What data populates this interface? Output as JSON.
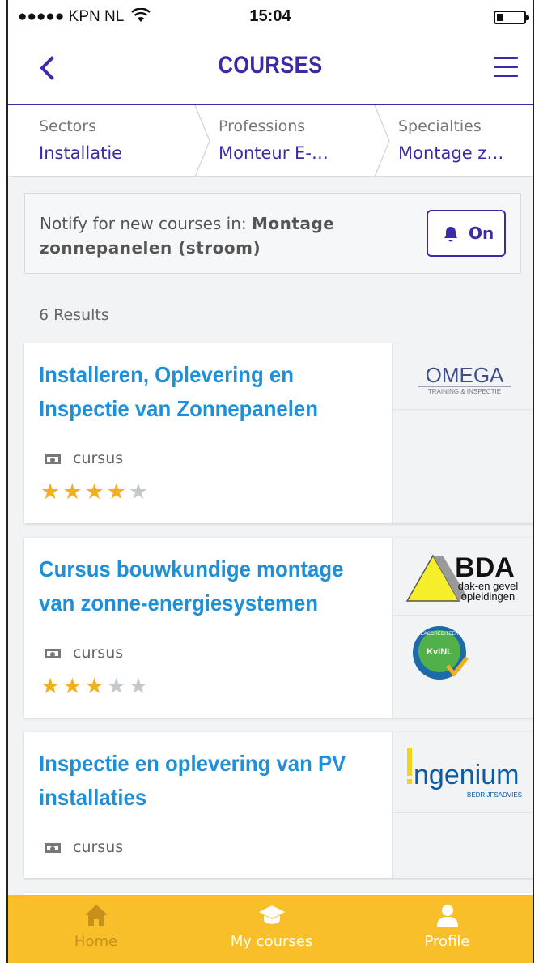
{
  "status_bar": {
    "carrier": "●●●●● KPN NL",
    "time": "15:04"
  },
  "header": {
    "title": "COURSES"
  },
  "breadcrumbs": [
    {
      "label": "Sectors",
      "value": "Installatie"
    },
    {
      "label": "Professions",
      "value": "Monteur E-…"
    },
    {
      "label": "Specialties",
      "value": "Montage z…"
    }
  ],
  "notify": {
    "prefix": "Notify for new courses in: ",
    "topic": "Montage zonnepanelen (stroom)",
    "button_label": "On"
  },
  "results": {
    "count_text": "6 Results"
  },
  "courses": [
    {
      "title": "Installeren, Oplevering en Inspectie van Zonnepanelen",
      "type": "cursus",
      "rating": 4,
      "providers": [
        "OMEGA"
      ],
      "provider_logo": {
        "name": "OMEGA",
        "tagline": "TRAINING & INSPECTIE"
      }
    },
    {
      "title": "Cursus bouwkundige montage van zonne-energiesystemen",
      "type": "cursus",
      "rating": 3,
      "provider_logo": {
        "name": "BDA",
        "tagline_1": "dak-en gevel",
        "tagline_2": "opleidingen"
      },
      "accreditation_logo": {
        "name": "KvINL",
        "tagline": "GEACCREDITEERD"
      }
    },
    {
      "title": "Inspectie en oplevering van PV installaties",
      "type": "cursus",
      "provider_logo": {
        "name": "ngenium",
        "tagline": "BEDRIJFSADVIES"
      }
    }
  ],
  "tabbar": [
    {
      "label": "Home",
      "icon": "home-icon",
      "active": true
    },
    {
      "label": "My courses",
      "icon": "graduation-cap-icon",
      "active": false
    },
    {
      "label": "Profile",
      "icon": "user-icon",
      "active": false
    }
  ],
  "colors": {
    "brand": "#3b2aa8",
    "title_blue": "#1e8fd9",
    "tabbar": "#f8bf2a",
    "star": "#f2b01e"
  }
}
